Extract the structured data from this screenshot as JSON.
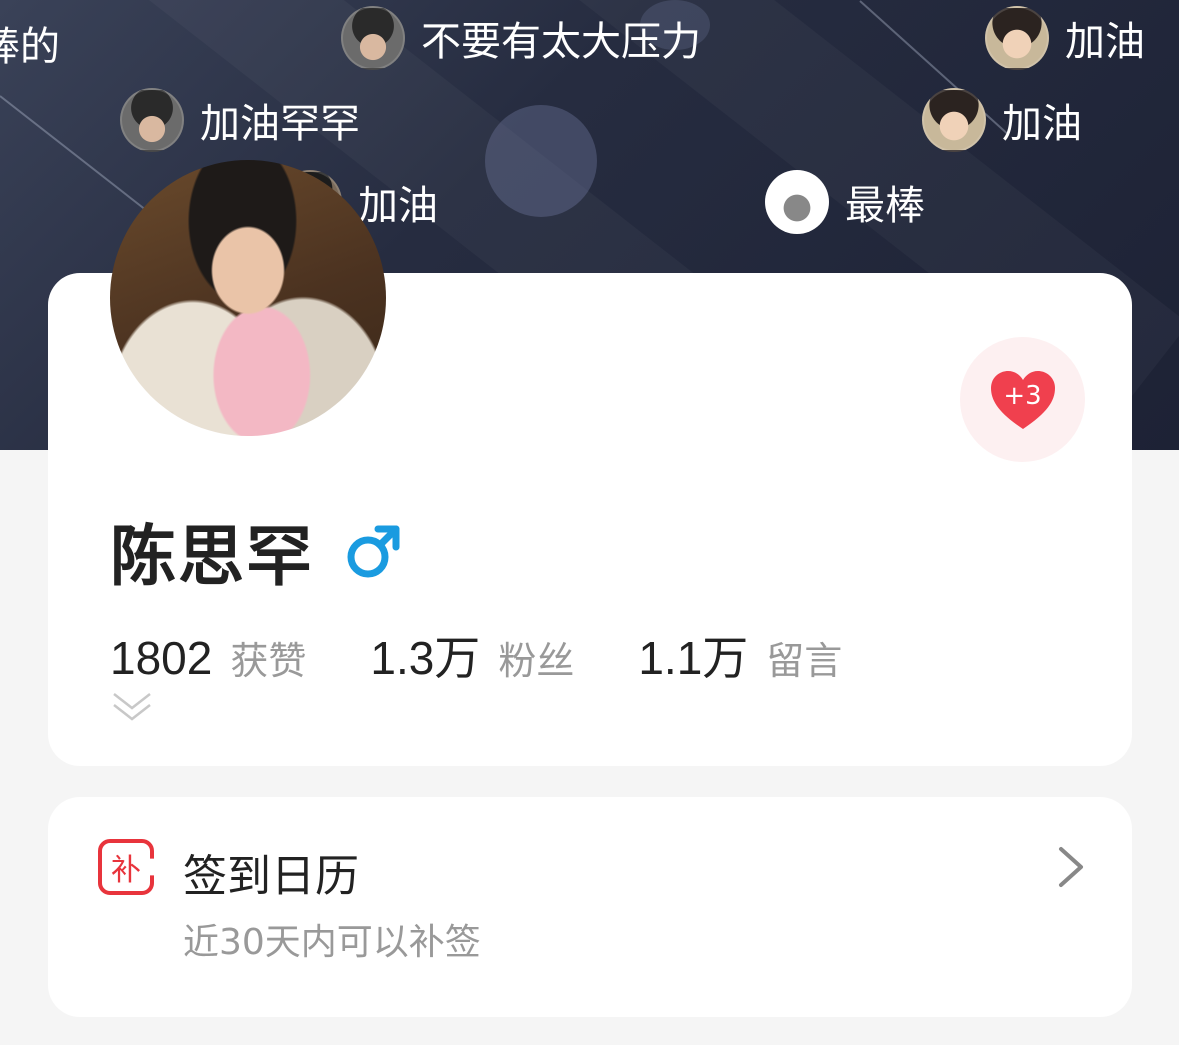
{
  "danmaku": [
    {
      "text": "棒的"
    },
    {
      "text": "不要有太大压力"
    },
    {
      "text": "加油"
    },
    {
      "text": "加油罕罕"
    },
    {
      "text": "加油"
    },
    {
      "text": "加油"
    },
    {
      "text": "最棒"
    }
  ],
  "like": {
    "label": "+3"
  },
  "profile": {
    "name": "陈思罕",
    "gender_symbol": "♂"
  },
  "stats": [
    {
      "value": "1802",
      "label": "获赞"
    },
    {
      "value": "1.3万",
      "label": "粉丝"
    },
    {
      "value": "1.1万",
      "label": "留言"
    }
  ],
  "calendar": {
    "icon_text": "补",
    "title": "签到日历",
    "subtitle": "近30天内可以补签"
  },
  "colors": {
    "accent_red": "#e8343c",
    "gender_blue": "#1a9be0",
    "heart_red": "#f0404e"
  }
}
